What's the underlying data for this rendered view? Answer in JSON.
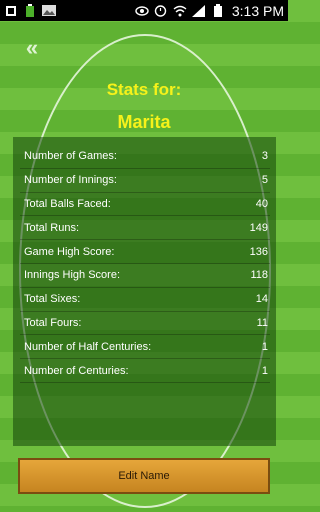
{
  "status_bar": {
    "time": "3:13 PM",
    "left_icons": [
      "notification-icon",
      "battery-small-icon",
      "image-icon"
    ],
    "right_icons": [
      "eye-icon",
      "alarm-icon",
      "wifi-icon",
      "signal-icon",
      "battery-icon"
    ]
  },
  "header": {
    "back_label": "«",
    "title": "Stats for:",
    "player_name": "Marita"
  },
  "stats": [
    {
      "label": "Number of Games:",
      "value": "3"
    },
    {
      "label": "Number of Innings:",
      "value": "5"
    },
    {
      "label": "Total Balls Faced:",
      "value": "40"
    },
    {
      "label": "Total Runs:",
      "value": "149"
    },
    {
      "label": "Game High Score:",
      "value": "136"
    },
    {
      "label": "Innings High Score:",
      "value": "118"
    },
    {
      "label": "Total Sixes:",
      "value": "14"
    },
    {
      "label": "Total Fours:",
      "value": "11"
    },
    {
      "label": "Number of Half Centuries:",
      "value": "1"
    },
    {
      "label": "Number of Centuries:",
      "value": "1"
    }
  ],
  "actions": {
    "edit_name_label": "Edit Name"
  },
  "colors": {
    "field_light": "#6fbf3e",
    "field_dark": "#5fb232",
    "title_yellow": "#f6f21a",
    "button": "#d8972c"
  }
}
